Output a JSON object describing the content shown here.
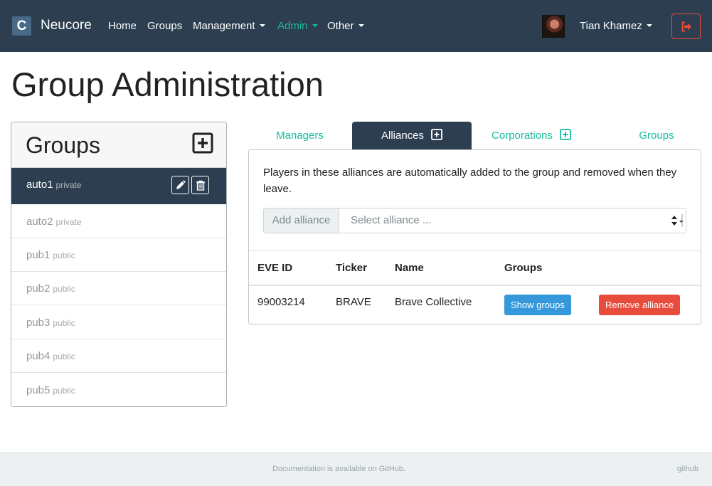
{
  "navbar": {
    "brand_letter": "C",
    "brand_name": "Neucore",
    "links": [
      "Home",
      "Groups",
      "Management",
      "Admin",
      "Other"
    ],
    "user_name": "Tian Khamez",
    "colors": {
      "background": "#2c3e50",
      "active": "#18bc9c",
      "logout": "#e74c3c"
    }
  },
  "page": {
    "title": "Group Administration"
  },
  "groups": {
    "title": "Groups",
    "items": [
      {
        "name": "auto1",
        "visibility": "private"
      },
      {
        "name": "auto2",
        "visibility": "private"
      },
      {
        "name": "pub1",
        "visibility": "public"
      },
      {
        "name": "pub2",
        "visibility": "public"
      },
      {
        "name": "pub3",
        "visibility": "public"
      },
      {
        "name": "pub4",
        "visibility": "public"
      },
      {
        "name": "pub5",
        "visibility": "public"
      }
    ]
  },
  "tabs": [
    "Managers",
    "Alliances",
    "Corporations",
    "Groups"
  ],
  "panel": {
    "description": "Players in these alliances are automatically added to the group and removed when they leave.",
    "add_label": "Add alliance",
    "select_placeholder": "Select alliance ...",
    "table": {
      "headers": [
        "EVE ID",
        "Ticker",
        "Name",
        "Groups"
      ],
      "rows": [
        {
          "eve_id": "99003214",
          "ticker": "BRAVE",
          "name": "Brave Collective",
          "show_label": "Show groups",
          "remove_label": "Remove alliance"
        }
      ]
    }
  },
  "footer": {
    "text": "Documentation is available on GitHub.",
    "link": "github"
  }
}
